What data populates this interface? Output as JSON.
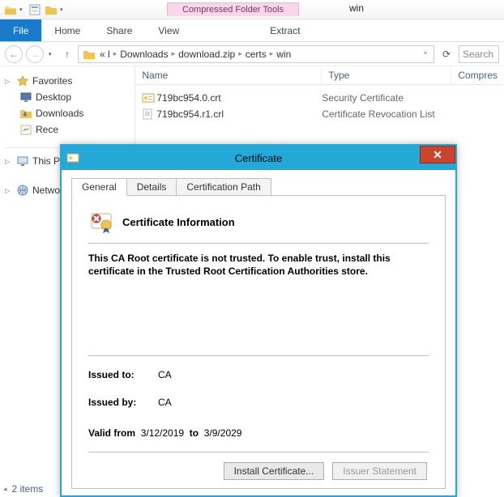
{
  "window": {
    "title": "win"
  },
  "toolsTab": {
    "label": "Compressed Folder Tools"
  },
  "ribbon": {
    "file": "File",
    "tabs": [
      "Home",
      "Share",
      "View"
    ],
    "extract": "Extract"
  },
  "addressBar": {
    "prefix": "« l",
    "crumbs": [
      "Downloads",
      "download.zip",
      "certs",
      "win"
    ]
  },
  "search": {
    "placeholder": "Search"
  },
  "nav": {
    "favorites": {
      "label": "Favorites",
      "items": [
        "Desktop",
        "Downloads",
        "Rece"
      ]
    },
    "thisPC": {
      "label": "This P"
    },
    "network": {
      "label": "Netwo"
    }
  },
  "columns": {
    "name": "Name",
    "type": "Type",
    "compressed": "Compres"
  },
  "files": [
    {
      "name": "719bc954.0.crt",
      "type": "Security Certificate"
    },
    {
      "name": "719bc954.r1.crl",
      "type": "Certificate Revocation List"
    }
  ],
  "status": {
    "items": "2 items"
  },
  "cert": {
    "title": "Certificate",
    "tabs": {
      "general": "General",
      "details": "Details",
      "path": "Certification Path"
    },
    "infoHeading": "Certificate Information",
    "trustMsg": "This CA Root certificate is not trusted. To enable trust, install this certificate in the Trusted Root Certification Authorities store.",
    "issuedToLabel": "Issued to:",
    "issuedTo": "CA",
    "issuedByLabel": "Issued by:",
    "issuedBy": "CA",
    "validFromLabel": "Valid from",
    "validFrom": "3/12/2019",
    "validToLabel": "to",
    "validTo": "3/9/2029",
    "installBtn": "Install Certificate...",
    "issuerBtn": "Issuer Statement"
  }
}
